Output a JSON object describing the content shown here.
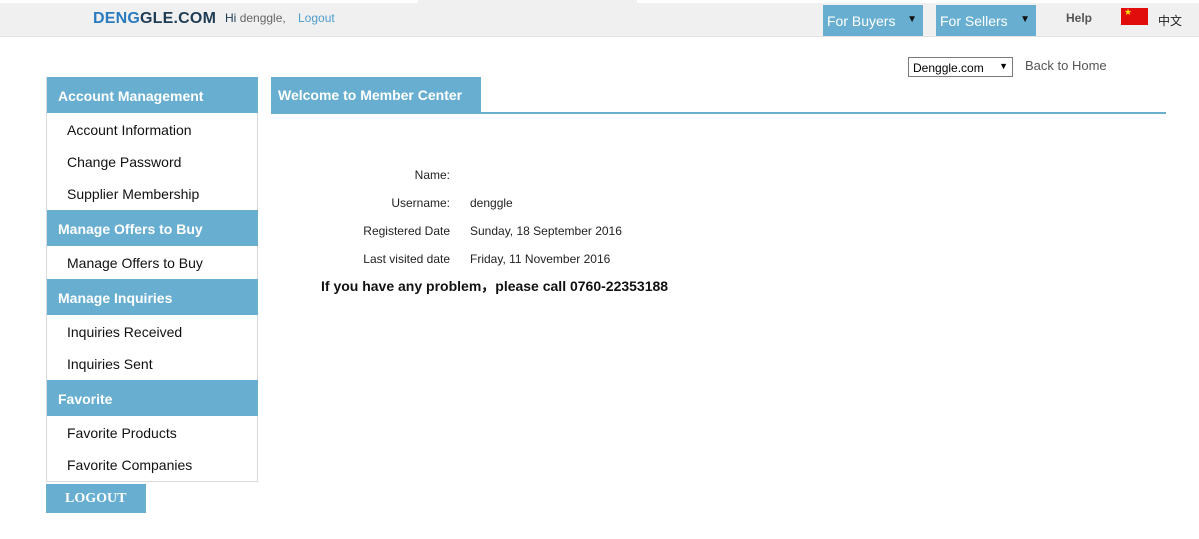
{
  "header": {
    "logo_part1": "DENG",
    "logo_part2": "GLE.COM",
    "hi_label": "Hi",
    "username": "denggle,",
    "logout_link": "Logout",
    "buyers_label": "For Buyers",
    "sellers_label": "For Sellers",
    "dropdown_arrow": "▼",
    "help_label": "Help",
    "language_label": "中文"
  },
  "site_select": {
    "value": "Denggle.com",
    "arrow": "▼"
  },
  "back_home": "Back to Home",
  "sidebar": {
    "sections": [
      {
        "title": "Account Management",
        "items": [
          "Account Information",
          "Change Password",
          "Supplier Membership"
        ]
      },
      {
        "title": "Manage Offers to Buy",
        "items": [
          "Manage Offers to Buy"
        ]
      },
      {
        "title": "Manage Inquiries",
        "items": [
          "Inquiries Received",
          "Inquiries Sent"
        ]
      },
      {
        "title": "Favorite",
        "items": [
          "Favorite Products",
          "Favorite Companies"
        ]
      }
    ],
    "logout_button": "LOGOUT"
  },
  "main": {
    "tab_title": "Welcome to Member Center",
    "fields": [
      {
        "label": "Name:",
        "value": ""
      },
      {
        "label": "Username:",
        "value": "denggle"
      },
      {
        "label": "Registered Date",
        "value": "Sunday, 18 September 2016"
      },
      {
        "label": "Last visited date",
        "value": "Friday, 11 November 2016"
      }
    ],
    "notice": "If you have any problem，please call 0760-22353188"
  },
  "colors": {
    "accent": "#67aed0",
    "logo_blue": "#2a7bbf",
    "logo_dark": "#1f3c55",
    "flag_red": "#e10c0c"
  },
  "icons": {
    "flag": "china-flag-icon",
    "dropdown": "chevron-down-icon"
  }
}
